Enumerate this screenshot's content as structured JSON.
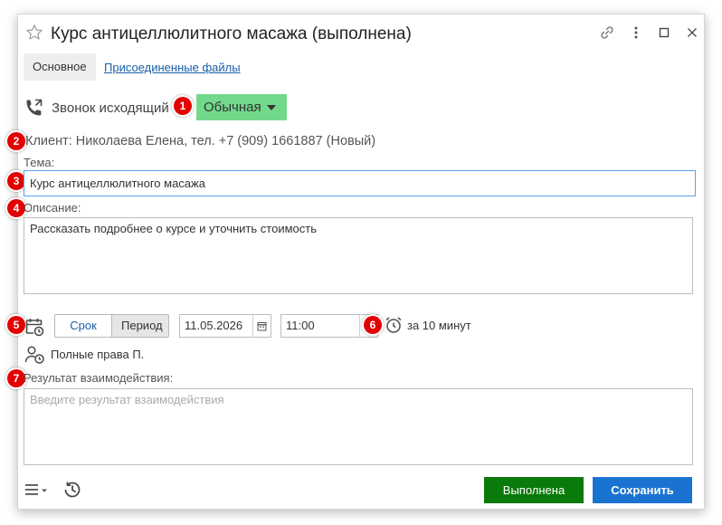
{
  "window": {
    "title": "Курс антицеллюлитного масажа (выполнена)"
  },
  "tabs": {
    "main": "Основное",
    "files": "Присоединенные файлы"
  },
  "call": {
    "type_label": "Звонок исходящий",
    "priority": "Обычная",
    "priority_color": "#72d98a"
  },
  "client": {
    "text": "Клиент: Николаева Елена, тел. +7 (909) 1661887 (Новый)"
  },
  "subject": {
    "label": "Тема:",
    "value": "Курс антицеллюлитного масажа"
  },
  "description": {
    "label": "Описание:",
    "value": "Рассказать подробнее о курсе и уточнить стоимость"
  },
  "schedule": {
    "mode_deadline": "Срок",
    "mode_period": "Период",
    "date": "11.05.2026",
    "time": "11:00",
    "reminder": "за 10 минут"
  },
  "responsible": {
    "name": "Полные права П."
  },
  "result": {
    "label": "Результат взаимодействия:",
    "placeholder": "Введите результат взаимодействия"
  },
  "actions": {
    "done": "Выполнена",
    "save": "Сохранить"
  },
  "badges": [
    "1",
    "2",
    "3",
    "4",
    "5",
    "6",
    "7"
  ],
  "colors": {
    "badge": "#e30000",
    "done_button": "#0a7a0a",
    "save_button": "#1a73d0",
    "link": "#1a5ea8"
  },
  "icons": {
    "favorite": "star-icon",
    "link": "link-icon",
    "more": "more-vertical-icon",
    "maximize": "maximize-icon",
    "close": "close-icon",
    "call": "phone-outgoing-icon",
    "calendar": "calendar-clock-icon",
    "alarm": "alarm-clock-icon",
    "user": "user-clock-icon",
    "menu": "menu-icon",
    "history": "history-icon"
  }
}
